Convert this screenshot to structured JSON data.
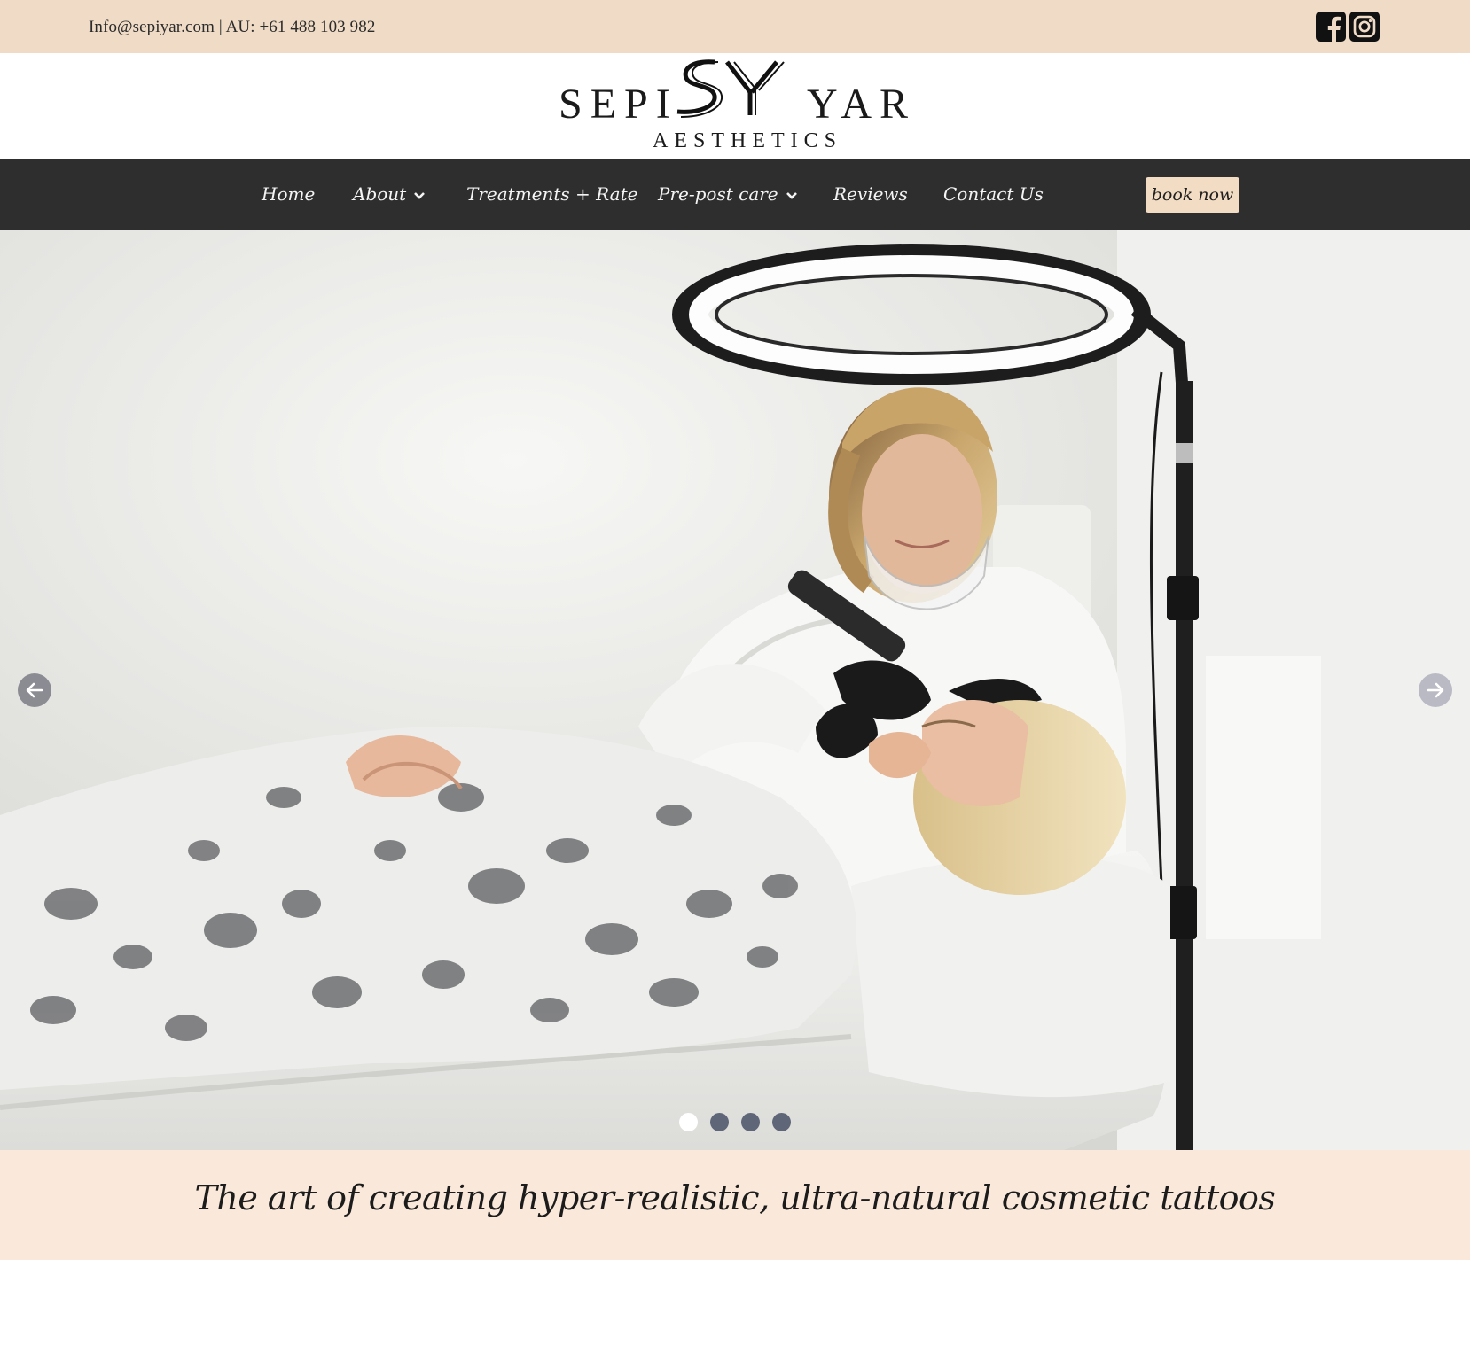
{
  "topbar": {
    "contact": "Info@sepiyar.com | AU: +61 488 103 982",
    "social": [
      {
        "icon": "facebook-icon"
      },
      {
        "icon": "instagram-icon"
      }
    ]
  },
  "logo": {
    "left_word": "SEPI",
    "monogram": "SY",
    "right_word": "YAR",
    "subtitle": "AESTHETICS"
  },
  "nav": {
    "items": [
      {
        "label": "Home"
      },
      {
        "label": "About",
        "dropdown": true
      },
      {
        "label": "Treatments + Rate"
      },
      {
        "label": "Pre-post care",
        "dropdown": true
      },
      {
        "label": "Reviews"
      },
      {
        "label": "Contact Us"
      }
    ],
    "cta": "book now"
  },
  "slider": {
    "slide_count": 4,
    "active_index": 0,
    "prev_icon": "arrow-left-icon",
    "next_icon": "arrow-right-icon"
  },
  "tagline": "The art of creating hyper-realistic, ultra-natural cosmetic tattoos",
  "colors": {
    "topbar_bg": "#f0dcc6",
    "nav_bg": "#2e2e2e",
    "cta_bg": "#f3dcc4",
    "tagline_bg": "#fae9da"
  }
}
